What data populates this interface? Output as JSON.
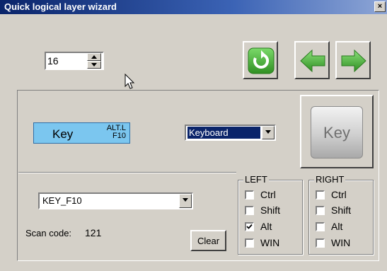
{
  "window": {
    "title": "Quick logical layer wizard",
    "close_label": "×"
  },
  "layer_spinner": {
    "value": "16"
  },
  "toolbar": {
    "refresh_icon": "refresh-icon",
    "back_icon": "arrow-left-icon",
    "forward_icon": "arrow-right-icon",
    "accent": "#3fa535"
  },
  "key_preview": {
    "label": "Key",
    "modifier_line1": "ALT.L",
    "modifier_line2": "F10",
    "bg_color": "#7bc6ef"
  },
  "device_select": {
    "selected": "Keyboard"
  },
  "big_key": {
    "label": "Key"
  },
  "key_select": {
    "selected": "KEY_F10"
  },
  "scan": {
    "label": "Scan code:",
    "value": "121"
  },
  "clear_button": {
    "label": "Clear"
  },
  "left_group": {
    "legend": "LEFT",
    "items": [
      {
        "label": "Ctrl",
        "checked": false
      },
      {
        "label": "Shift",
        "checked": false
      },
      {
        "label": "Alt",
        "checked": true
      },
      {
        "label": "WIN",
        "checked": false
      }
    ]
  },
  "right_group": {
    "legend": "RIGHT",
    "items": [
      {
        "label": "Ctrl",
        "checked": false
      },
      {
        "label": "Shift",
        "checked": false
      },
      {
        "label": "Alt",
        "checked": false
      },
      {
        "label": "WIN",
        "checked": false
      }
    ]
  }
}
